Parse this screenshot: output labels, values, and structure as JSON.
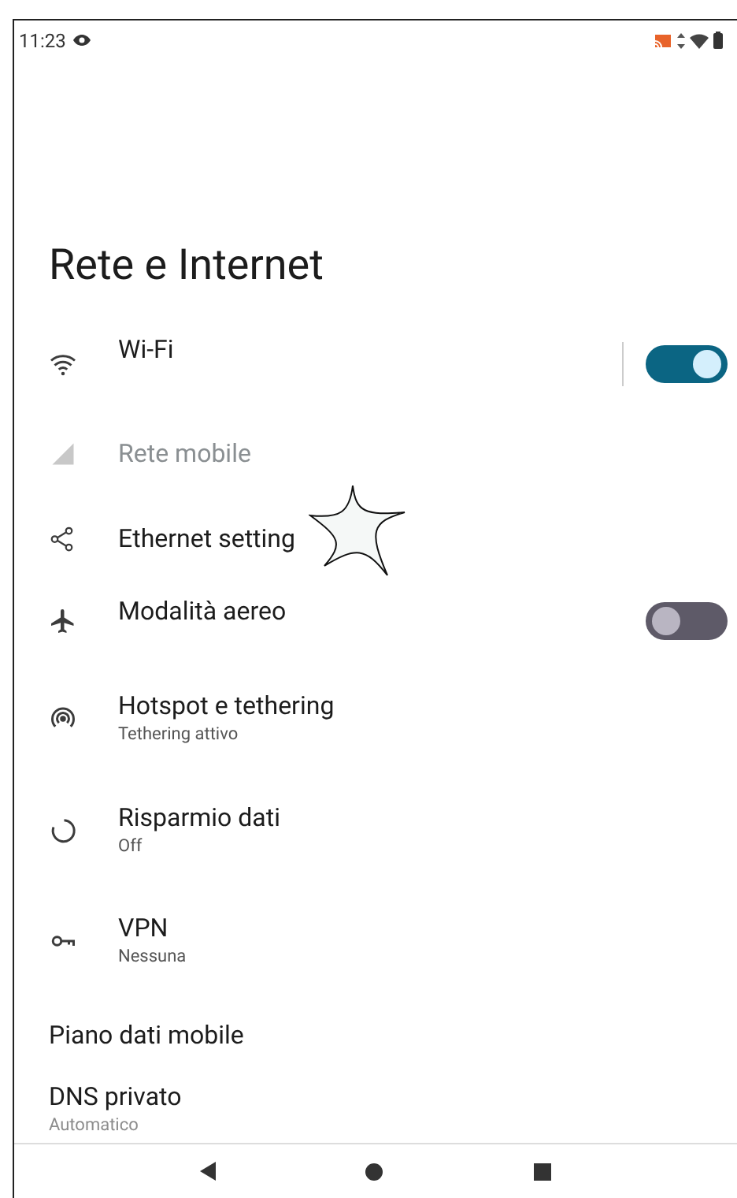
{
  "status_bar": {
    "time": "11:23"
  },
  "title": "Rete e Internet",
  "items": [
    {
      "kind": "toggle",
      "title": "Wi-Fi",
      "on": true,
      "disabled": false
    },
    {
      "kind": "plain",
      "title": "Rete mobile",
      "disabled": true
    },
    {
      "kind": "plain",
      "title": "Ethernet setting",
      "disabled": false
    },
    {
      "kind": "toggle",
      "title": "Modalità aereo",
      "on": false,
      "disabled": false
    },
    {
      "kind": "plain",
      "title": "Hotspot e tethering",
      "summary": "Tethering attivo",
      "disabled": false
    },
    {
      "kind": "plain",
      "title": "Risparmio dati",
      "summary": "Off",
      "disabled": false
    },
    {
      "kind": "plain",
      "title": "VPN",
      "summary": "Nessuna",
      "disabled": false
    },
    {
      "kind": "noicon",
      "title": "Piano dati mobile",
      "disabled": false
    },
    {
      "kind": "noicon",
      "title": "DNS privato",
      "summary": "Automatico",
      "disabled": false
    }
  ]
}
